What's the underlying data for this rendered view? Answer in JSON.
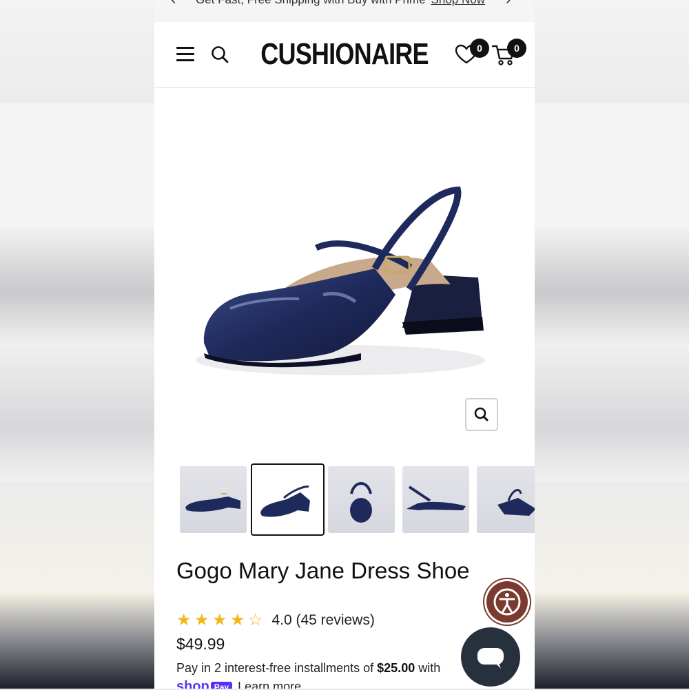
{
  "announcement": {
    "message": "Get Fast, Free Shipping with Buy with Prime",
    "link": "Shop Now",
    "prev_icon": "chevron-left-icon",
    "next_icon": "chevron-right-icon"
  },
  "header": {
    "logo": "CUSHIONAIRE",
    "wishlist_count": "0",
    "cart_count": "0",
    "menu_icon": "hamburger-icon",
    "search_icon": "search-icon",
    "wishlist_icon": "heart-icon",
    "cart_icon": "cart-icon"
  },
  "gallery": {
    "zoom_icon": "magnifier-icon",
    "thumbnail_count": 5,
    "active_thumbnail": 2
  },
  "product": {
    "title": "Gogo Mary Jane Dress Shoe",
    "rating_value": 4,
    "rating_max": 5,
    "rating_text": "4.0 (45 reviews)",
    "price": "$49.99"
  },
  "payment": {
    "installments_prefix": "Pay in 2 interest-free installments of",
    "installment_amount": "$25.00",
    "installments_suffix": "with",
    "shop_logo": "shop",
    "pay_badge": "Pay",
    "learn_more": "Learn more"
  },
  "widgets": {
    "accessibility_icon": "accessibility-icon",
    "chat_icon": "chat-bubble-icon"
  },
  "colors": {
    "shoe": "#1f2a5c",
    "star": "#f2b51b",
    "accessibility_bg": "#7a3a30",
    "chat_bg": "#27313d",
    "shop_pay": "#5a31f4"
  }
}
